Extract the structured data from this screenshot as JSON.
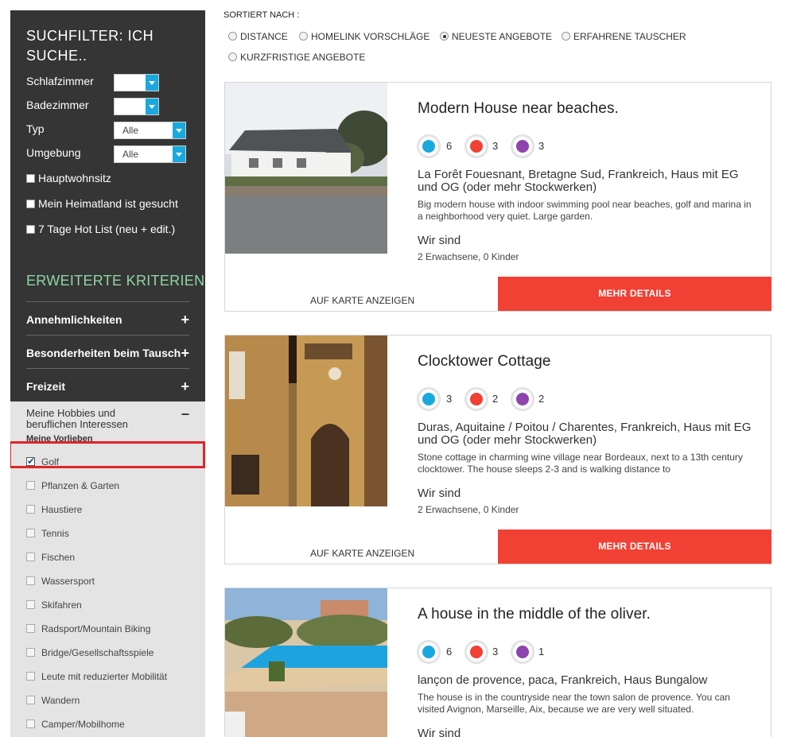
{
  "sidebar": {
    "title": "SUCHFILTER: ICH SUCHE..",
    "filters": [
      {
        "label": "Schlafzimmer",
        "value": ""
      },
      {
        "label": "Badezimmer",
        "value": ""
      },
      {
        "label": "Typ",
        "value": "Alle"
      },
      {
        "label": "Umgebung",
        "value": "Alle"
      }
    ],
    "checkboxes": [
      "Hauptwohnsitz",
      "Mein Heimatland ist gesucht",
      "7 Tage Hot List (neu + edit.)"
    ],
    "advanced_heading": "ERWEITERTE KRITERIEN",
    "sections": [
      "Annehmlichkeiten",
      "Besonderheiten beim Tausch",
      "Freizeit"
    ],
    "hobby_title": "Meine Hobbies und beruflichen Interessen",
    "hobby_sub": "Meine Vorlieben",
    "hobbies": [
      "Golf",
      "Pflanzen & Garten",
      "Haustiere",
      "Tennis",
      "Fischen",
      "Wassersport",
      "Skifahren",
      "Radsport/Mountain Biking",
      "Bridge/Gesellschaftsspiele",
      "Leute mit reduzierter Mobilität",
      "Wandern",
      "Camper/Mobilhome"
    ],
    "checked_hobby": "Golf"
  },
  "sort": {
    "label": "SORTIERT NACH :",
    "options": [
      "DISTANCE",
      "HOMELINK VORSCHLÄGE",
      "NEUESTE ANGEBOTE",
      "ERFAHRENE TAUSCHER",
      "KURZFRISTIGE ANGEBOTE"
    ],
    "selected": "NEUESTE ANGEBOTE"
  },
  "colors": {
    "people": "#19a9df",
    "beds": "#f04134",
    "baths": "#8e44ad",
    "accent_green": "#8fd5a4"
  },
  "listings": [
    {
      "title": "Modern House near beaches.",
      "people": "6",
      "beds": "3",
      "baths": "3",
      "location": "La Forêt Fouesnant, Bretagne Sud, Frankreich, Haus mit EG und OG (oder mehr Stockwerken)",
      "description": "Big modern house with indoor swimming pool near beaches, golf and marina in a neighborhood very quiet. Large garden.",
      "wir_sind": "Wir sind",
      "guests": "2 Erwachsene, 0 Kinder",
      "map_label": "AUF KARTE ANZEIGEN",
      "details_label": "MEHR DETAILS"
    },
    {
      "title": "Clocktower Cottage",
      "people": "3",
      "beds": "2",
      "baths": "2",
      "location": "Duras, Aquitaine / Poitou / Charentes, Frankreich, Haus mit EG und OG (oder mehr Stockwerken)",
      "description": "Stone cottage in charming wine village near Bordeaux, next to a 13th century clocktower. The house sleeps 2-3 and is walking distance to",
      "wir_sind": "Wir sind",
      "guests": "2 Erwachsene, 0 Kinder",
      "map_label": "AUF KARTE ANZEIGEN",
      "details_label": "MEHR DETAILS"
    },
    {
      "title": "A house in the middle of the oliver.",
      "people": "6",
      "beds": "3",
      "baths": "1",
      "location": "lançon de provence, paca, Frankreich, Haus Bungalow",
      "description": "The house is in the countryside near the town salon de provence. You can visited Avignon, Marseille, Aix, because we are very well situated.",
      "wir_sind": "Wir sind"
    }
  ]
}
